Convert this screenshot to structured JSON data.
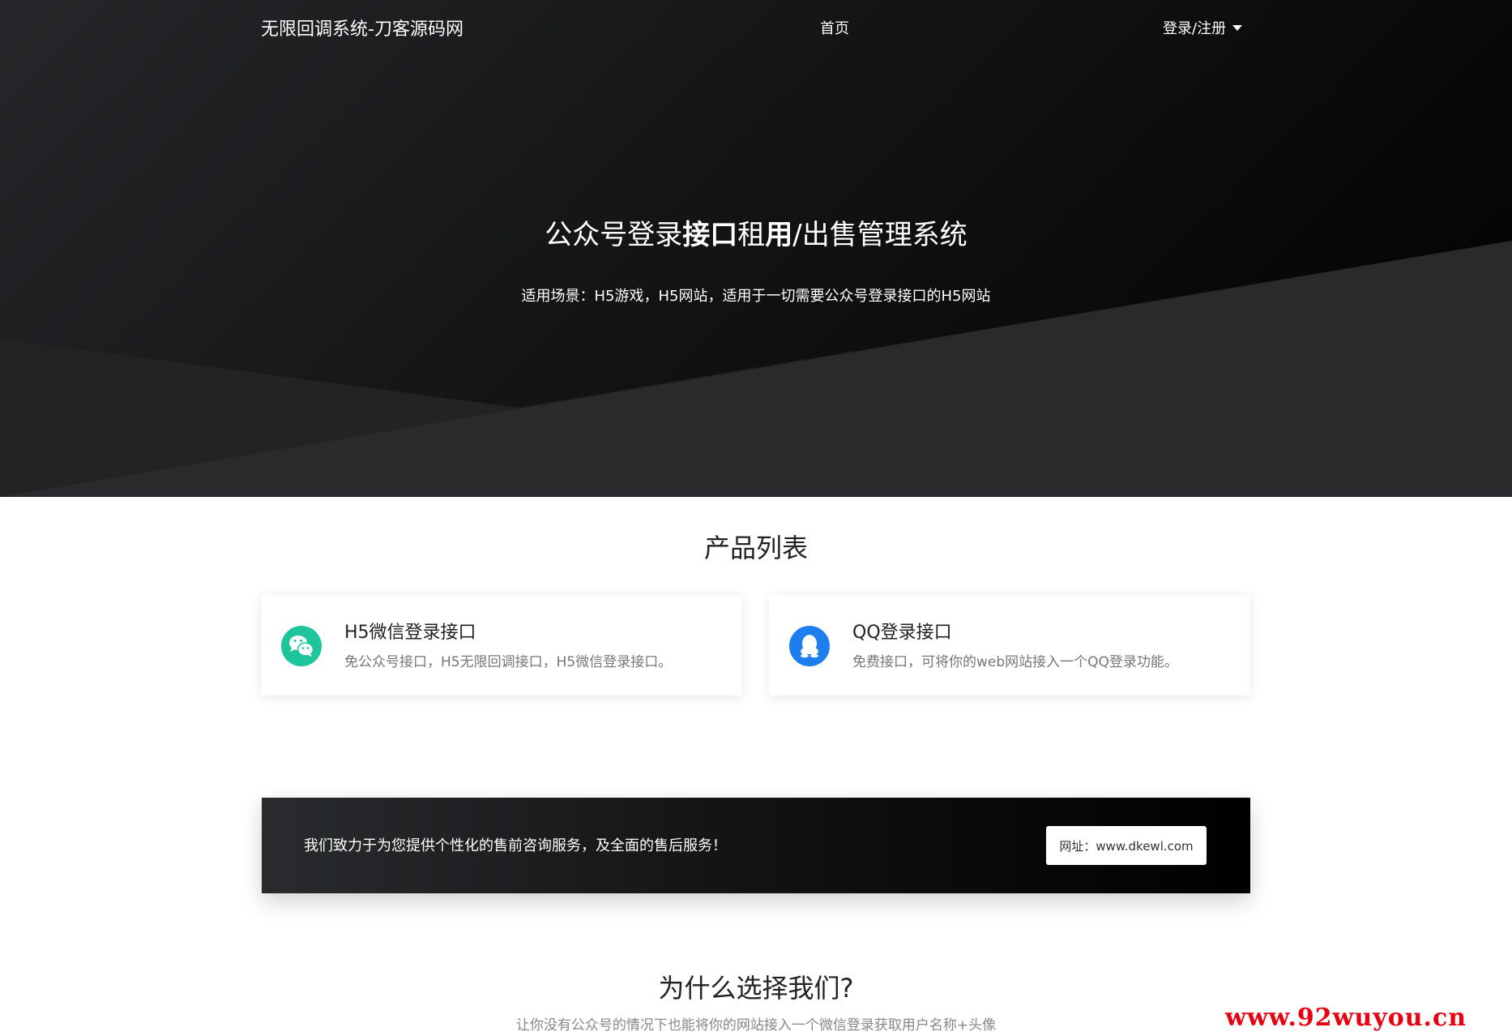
{
  "header": {
    "brand": "无限回调系统-刀客源码网",
    "nav_home": "首页",
    "nav_login": "登录/注册"
  },
  "hero": {
    "title_part1": "公众号登录",
    "title_bold1": "接口",
    "title_part2": "租",
    "title_bold2": "用",
    "title_part3": "/出售管理系统",
    "subtitle": "适用场景：H5游戏，H5网站，适用于一切需要公众号登录接口的H5网站"
  },
  "products": {
    "title": "产品列表",
    "items": [
      {
        "title": "H5微信登录接口",
        "desc": "免公众号接口，H5无限回调接口，H5微信登录接口。",
        "icon": "wechat-icon",
        "color": "#1ec59a"
      },
      {
        "title": "QQ登录接口",
        "desc": "免费接口，可将你的web网站接入一个QQ登录功能。",
        "icon": "qq-icon",
        "color": "#1e7ef0"
      }
    ]
  },
  "cta": {
    "text": "我们致力于为您提供个性化的售前咨询服务，及全面的售后服务！",
    "button": "网址：www.dkewl.com"
  },
  "why": {
    "title": "为什么选择我们?",
    "subtitle": "让你没有公众号的情况下也能将你的网站接入一个微信登录获取用户名称+头像"
  },
  "watermark": "www.92wuyou.cn"
}
